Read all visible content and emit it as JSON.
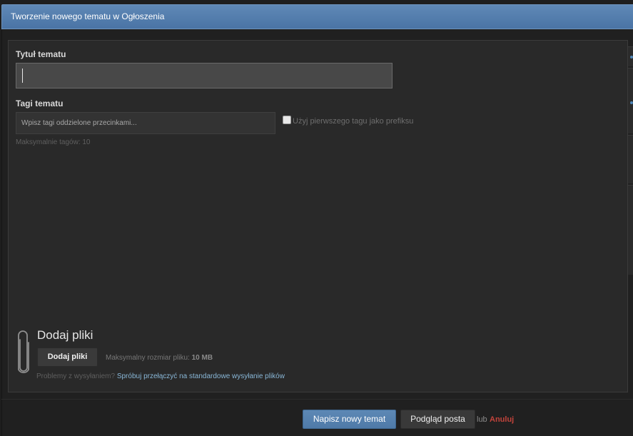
{
  "window": {
    "title": "Tworzenie nowego tematu w Ogłoszenia"
  },
  "form": {
    "title_label": "Tytuł tematu",
    "title_value": "",
    "tags_label": "Tagi tematu",
    "tags_placeholder": "Wpisz tagi oddzielone przecinkami...",
    "prefix_checkbox_label": "Użyj pierwszego tagu jako prefiksu",
    "prefix_checked": false,
    "max_tags_hint": "Maksymalnie tagów: 10"
  },
  "attachments": {
    "heading": "Dodaj pliki",
    "button_label": "Dodaj pliki",
    "max_size_label": "Maksymalny rozmiar pliku:",
    "max_size_value": "10 MB",
    "problems_text": "Problemy z wysyłaniem?",
    "switch_link": "Spróbuj przełączyć na standardowe wysyłanie plików",
    "clip_icon": "paperclip-icon"
  },
  "footer": {
    "submit_label": "Napisz nowy temat",
    "preview_label": "Podgląd posta",
    "or_text": "lub",
    "cancel_label": "Anuluj"
  },
  "colors": {
    "accent": "#5d88b5",
    "cancel": "#c2433b",
    "link": "#89b7d7"
  }
}
